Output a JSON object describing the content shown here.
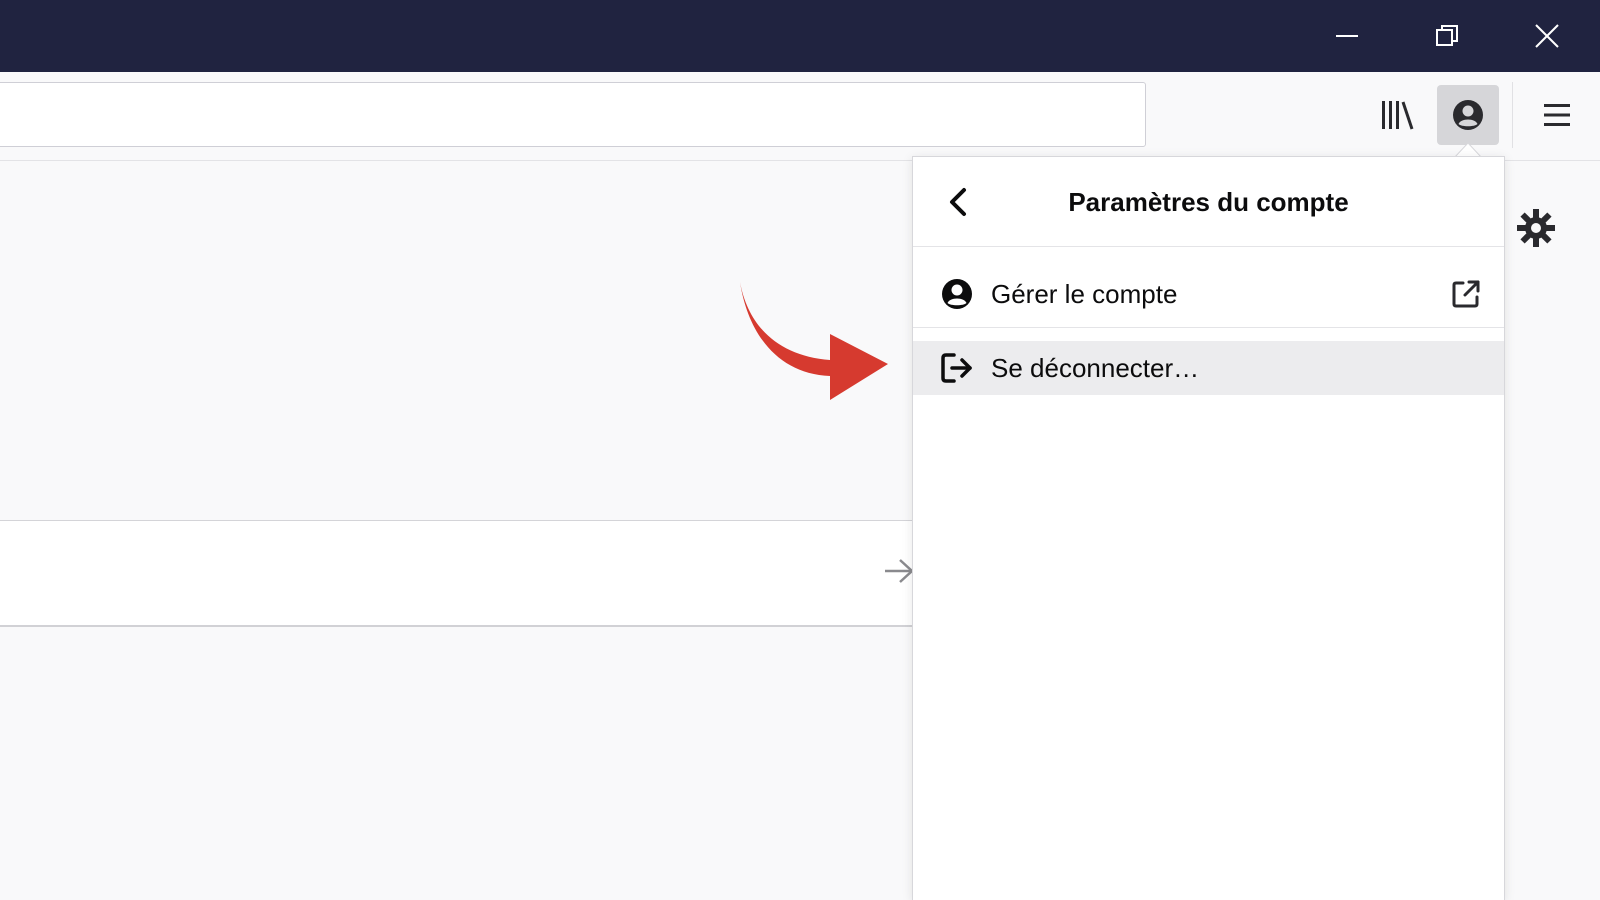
{
  "window": {
    "controls": {
      "minimize": "minimize-icon",
      "restore": "restore-icon",
      "close": "close-icon"
    },
    "titlebar_color": "#202340"
  },
  "toolbar": {
    "library_icon": "library-icon",
    "account_icon": "account-icon",
    "menu_icon": "hamburger-menu-icon"
  },
  "panel": {
    "title": "Paramètres du compte",
    "items": [
      {
        "label": "Gérer le compte",
        "icon": "account-circle-icon",
        "trailing_icon": "external-link-icon"
      },
      {
        "label": "Se déconnecter…",
        "icon": "sign-out-icon",
        "highlighted": true
      }
    ]
  },
  "annotation": {
    "arrow_color": "#d63a2f"
  }
}
